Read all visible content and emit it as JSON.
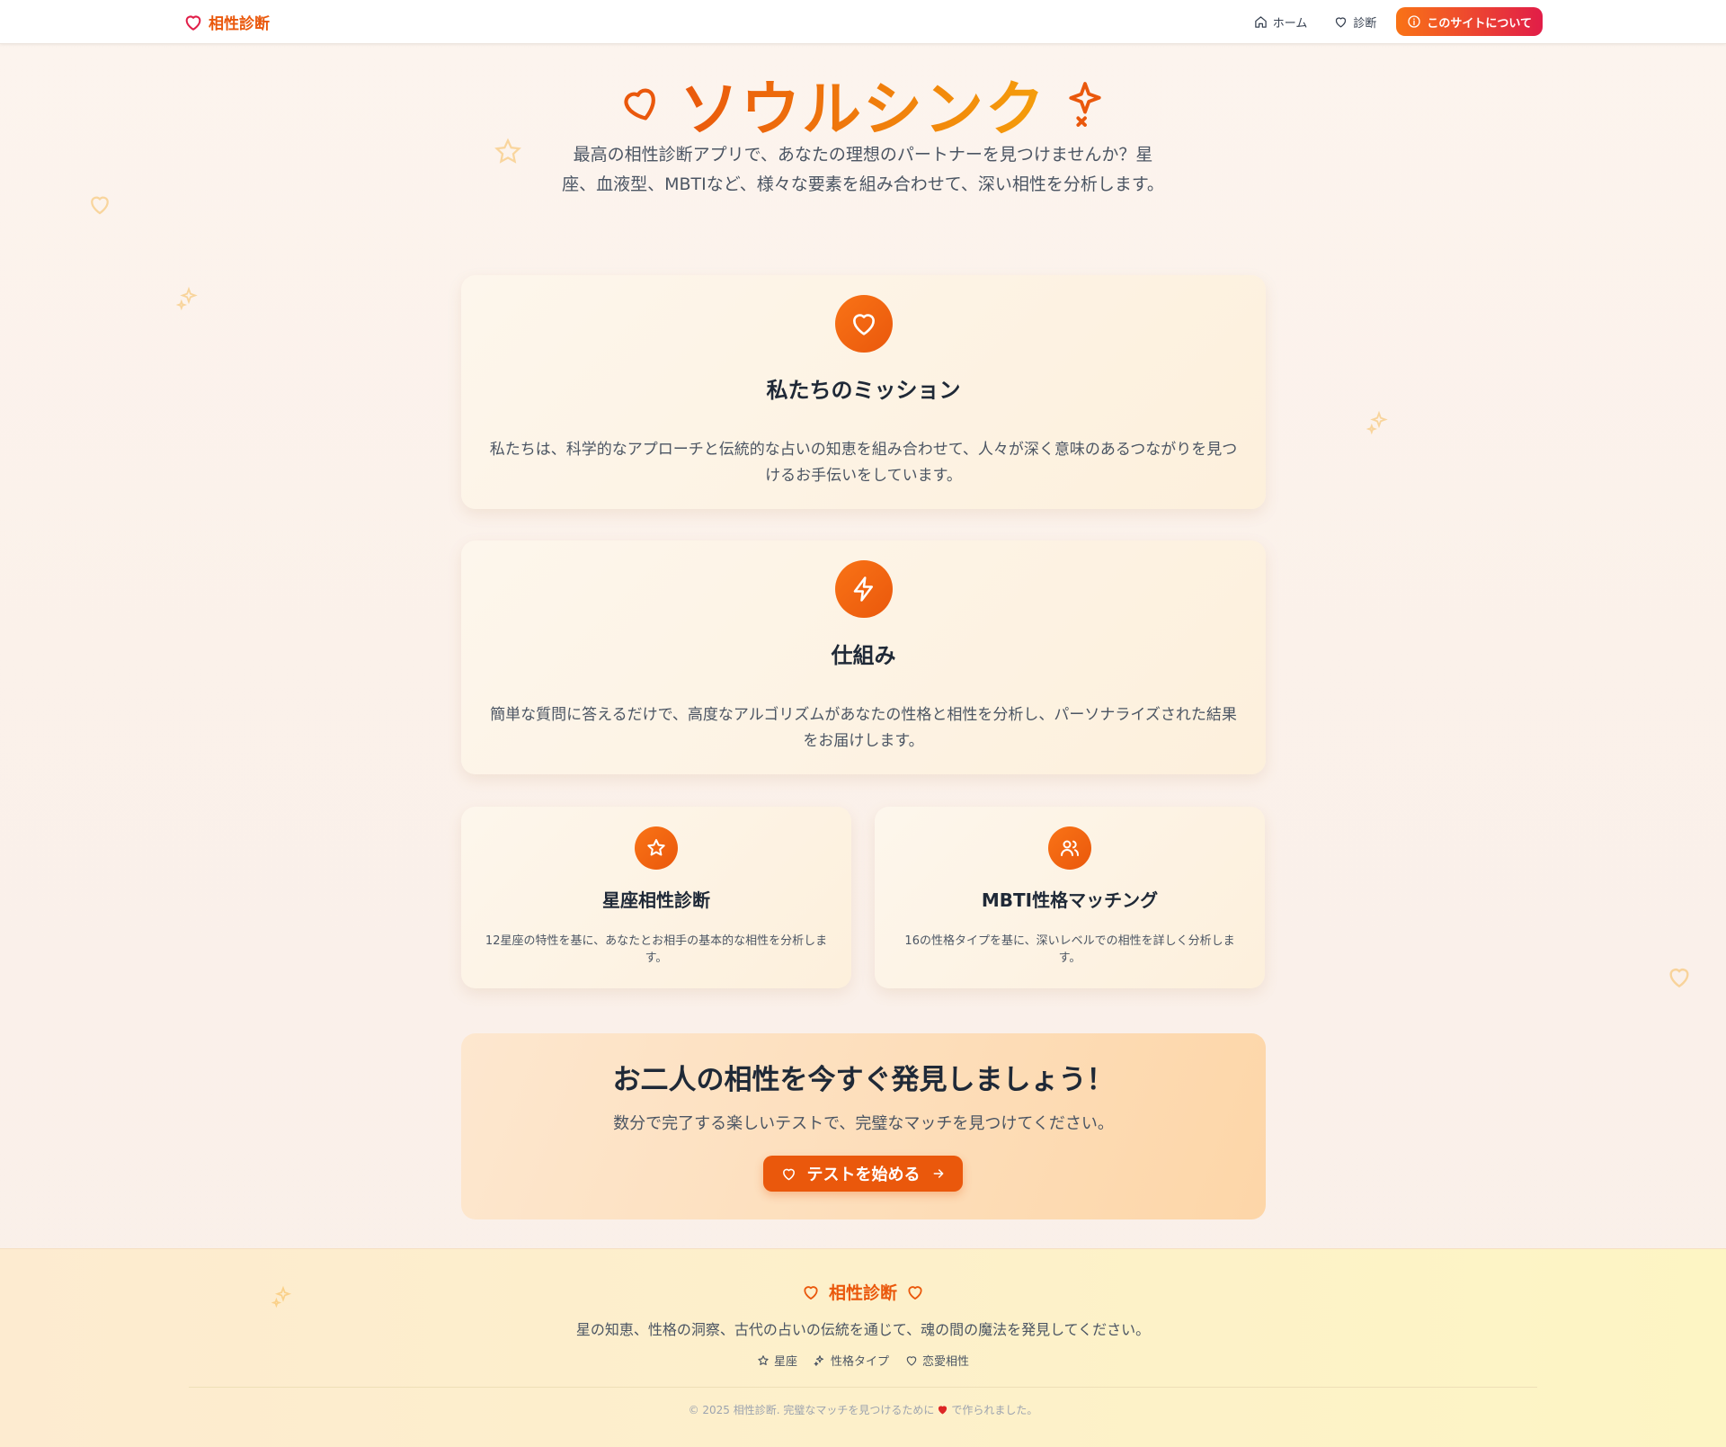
{
  "header": {
    "brand": "相性診断",
    "nav": [
      {
        "label": "ホーム",
        "icon": "home-icon"
      },
      {
        "label": "診断",
        "icon": "heart-icon"
      },
      {
        "label": "このサイトについて",
        "icon": "info-icon"
      }
    ]
  },
  "hero": {
    "title": "ソウルシンク",
    "description": "最高の相性診断アプリで、あなたの理想のパートナーを見つけませんか？星座、血液型、MBTIなど、様々な要素を組み合わせて、深い相性を分析します。"
  },
  "mission": {
    "title": "私たちのミッション",
    "text": "私たちは、科学的なアプローチと伝統的な占いの知恵を組み合わせて、人々が深く意味のあるつながりを見つけるお手伝いをしています。"
  },
  "how": {
    "title": "仕組み",
    "text": "簡単な質問に答えるだけで、高度なアルゴリズムがあなたの性格と相性を分析し、パーソナライズされた結果をお届けします。"
  },
  "features": [
    {
      "title": "星座相性診断",
      "text": "12星座の特性を基に、あなたとお相手の基本的な相性を分析します。"
    },
    {
      "title": "MBTI性格マッチング",
      "text": "16の性格タイプを基に、深いレベルでの相性を詳しく分析します。"
    }
  ],
  "cta": {
    "title": "お二人の相性を今すぐ発見しましょう！",
    "subtitle": "数分で完了する楽しいテストで、完璧なマッチを見つけてください。",
    "button": "テストを始める"
  },
  "footer": {
    "brand": "相性診断",
    "description": "星の知恵、性格の洞察、古代の占いの伝統を通じて、魂の間の魔法を発見してください。",
    "links": [
      {
        "label": "星座",
        "icon": "star-icon"
      },
      {
        "label": "性格タイプ",
        "icon": "sparkles-icon"
      },
      {
        "label": "恋愛相性",
        "icon": "heart-icon"
      }
    ],
    "copyright_prefix": "© 2025 相性診断. 完璧なマッチを見つけるために",
    "copyright_suffix": "で作られました。"
  },
  "colors": {
    "accent": "#ea580c",
    "accent_gradient_end": "#e11d48",
    "text": "#1f2937"
  }
}
